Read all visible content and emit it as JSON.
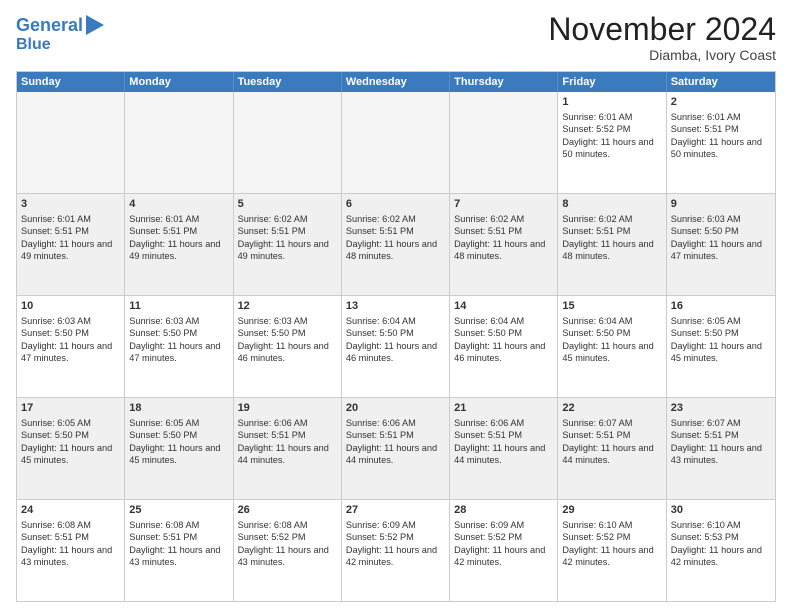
{
  "header": {
    "logo_line1": "General",
    "logo_line2": "Blue",
    "month": "November 2024",
    "location": "Diamba, Ivory Coast"
  },
  "days_of_week": [
    "Sunday",
    "Monday",
    "Tuesday",
    "Wednesday",
    "Thursday",
    "Friday",
    "Saturday"
  ],
  "weeks": [
    [
      {
        "day": "",
        "empty": true
      },
      {
        "day": "",
        "empty": true
      },
      {
        "day": "",
        "empty": true
      },
      {
        "day": "",
        "empty": true
      },
      {
        "day": "",
        "empty": true
      },
      {
        "day": "1",
        "sunrise": "6:01 AM",
        "sunset": "5:52 PM",
        "daylight": "11 hours and 50 minutes."
      },
      {
        "day": "2",
        "sunrise": "6:01 AM",
        "sunset": "5:51 PM",
        "daylight": "11 hours and 50 minutes."
      }
    ],
    [
      {
        "day": "3",
        "sunrise": "6:01 AM",
        "sunset": "5:51 PM",
        "daylight": "11 hours and 49 minutes."
      },
      {
        "day": "4",
        "sunrise": "6:01 AM",
        "sunset": "5:51 PM",
        "daylight": "11 hours and 49 minutes."
      },
      {
        "day": "5",
        "sunrise": "6:02 AM",
        "sunset": "5:51 PM",
        "daylight": "11 hours and 49 minutes."
      },
      {
        "day": "6",
        "sunrise": "6:02 AM",
        "sunset": "5:51 PM",
        "daylight": "11 hours and 48 minutes."
      },
      {
        "day": "7",
        "sunrise": "6:02 AM",
        "sunset": "5:51 PM",
        "daylight": "11 hours and 48 minutes."
      },
      {
        "day": "8",
        "sunrise": "6:02 AM",
        "sunset": "5:51 PM",
        "daylight": "11 hours and 48 minutes."
      },
      {
        "day": "9",
        "sunrise": "6:03 AM",
        "sunset": "5:50 PM",
        "daylight": "11 hours and 47 minutes."
      }
    ],
    [
      {
        "day": "10",
        "sunrise": "6:03 AM",
        "sunset": "5:50 PM",
        "daylight": "11 hours and 47 minutes."
      },
      {
        "day": "11",
        "sunrise": "6:03 AM",
        "sunset": "5:50 PM",
        "daylight": "11 hours and 47 minutes."
      },
      {
        "day": "12",
        "sunrise": "6:03 AM",
        "sunset": "5:50 PM",
        "daylight": "11 hours and 46 minutes."
      },
      {
        "day": "13",
        "sunrise": "6:04 AM",
        "sunset": "5:50 PM",
        "daylight": "11 hours and 46 minutes."
      },
      {
        "day": "14",
        "sunrise": "6:04 AM",
        "sunset": "5:50 PM",
        "daylight": "11 hours and 46 minutes."
      },
      {
        "day": "15",
        "sunrise": "6:04 AM",
        "sunset": "5:50 PM",
        "daylight": "11 hours and 45 minutes."
      },
      {
        "day": "16",
        "sunrise": "6:05 AM",
        "sunset": "5:50 PM",
        "daylight": "11 hours and 45 minutes."
      }
    ],
    [
      {
        "day": "17",
        "sunrise": "6:05 AM",
        "sunset": "5:50 PM",
        "daylight": "11 hours and 45 minutes."
      },
      {
        "day": "18",
        "sunrise": "6:05 AM",
        "sunset": "5:50 PM",
        "daylight": "11 hours and 45 minutes."
      },
      {
        "day": "19",
        "sunrise": "6:06 AM",
        "sunset": "5:51 PM",
        "daylight": "11 hours and 44 minutes."
      },
      {
        "day": "20",
        "sunrise": "6:06 AM",
        "sunset": "5:51 PM",
        "daylight": "11 hours and 44 minutes."
      },
      {
        "day": "21",
        "sunrise": "6:06 AM",
        "sunset": "5:51 PM",
        "daylight": "11 hours and 44 minutes."
      },
      {
        "day": "22",
        "sunrise": "6:07 AM",
        "sunset": "5:51 PM",
        "daylight": "11 hours and 44 minutes."
      },
      {
        "day": "23",
        "sunrise": "6:07 AM",
        "sunset": "5:51 PM",
        "daylight": "11 hours and 43 minutes."
      }
    ],
    [
      {
        "day": "24",
        "sunrise": "6:08 AM",
        "sunset": "5:51 PM",
        "daylight": "11 hours and 43 minutes."
      },
      {
        "day": "25",
        "sunrise": "6:08 AM",
        "sunset": "5:51 PM",
        "daylight": "11 hours and 43 minutes."
      },
      {
        "day": "26",
        "sunrise": "6:08 AM",
        "sunset": "5:52 PM",
        "daylight": "11 hours and 43 minutes."
      },
      {
        "day": "27",
        "sunrise": "6:09 AM",
        "sunset": "5:52 PM",
        "daylight": "11 hours and 42 minutes."
      },
      {
        "day": "28",
        "sunrise": "6:09 AM",
        "sunset": "5:52 PM",
        "daylight": "11 hours and 42 minutes."
      },
      {
        "day": "29",
        "sunrise": "6:10 AM",
        "sunset": "5:52 PM",
        "daylight": "11 hours and 42 minutes."
      },
      {
        "day": "30",
        "sunrise": "6:10 AM",
        "sunset": "5:53 PM",
        "daylight": "11 hours and 42 minutes."
      }
    ]
  ]
}
